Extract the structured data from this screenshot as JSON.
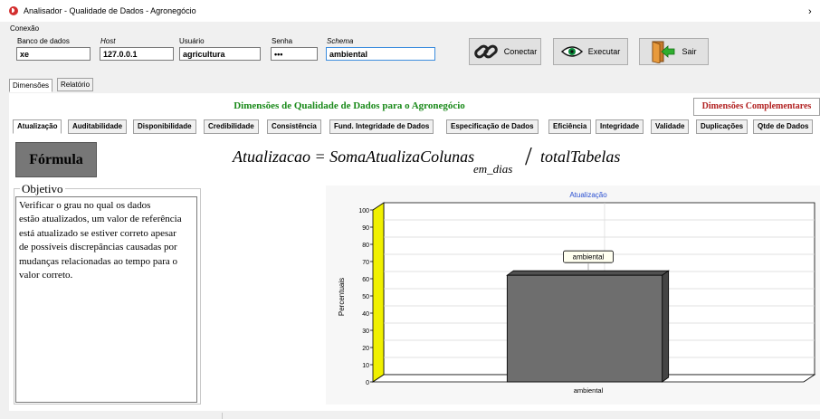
{
  "window": {
    "title": "Analisador - Qualidade de Dados - Agronegócio",
    "close_glyph": "›",
    "app_icon": "red-circle-app-icon"
  },
  "connection": {
    "group_label": "Conexão",
    "fields": [
      {
        "label": "Banco de dados",
        "value": "xe"
      },
      {
        "label": "Host",
        "value": "127.0.0.1"
      },
      {
        "label": "Usuário",
        "value": "agricultura"
      },
      {
        "label": "Senha",
        "value": "•••"
      },
      {
        "label": "Schema",
        "value": "ambiental"
      }
    ],
    "buttons": {
      "connect": "Conectar",
      "execute": "Executar",
      "exit": "Sair"
    }
  },
  "main_tabs": [
    "Dimensões",
    "Relatório"
  ],
  "headings": {
    "main": "Dimensões de Qualidade de Dados para o Agronegócio",
    "complementary": "Dimensões Complementares"
  },
  "dimension_tabs": [
    "Atualização",
    "Auditabilidade",
    "Disponibilidade",
    "Credibilidade",
    "Consistência",
    "Fund. Integridade de Dados",
    "Especificação de Dados",
    "Eficiência",
    "Integridade",
    "Validade",
    "Duplicações",
    "Qtde de Dados"
  ],
  "formula": {
    "label": "Fórmula",
    "lhs": "Atualizacao = SomaAtualizaColunas",
    "subscript": "em_dias",
    "slash": "/",
    "rhs": "totalTabelas"
  },
  "objective": {
    "legend": "Objetivo",
    "lines": [
      "Verificar o grau no qual os dados",
      "estão atualizados, um valor de referência",
      "está atualizado se estiver correto apesar",
      "de possíveis discrepâncias causadas por",
      "mudanças relacionadas ao tempo para o",
      "valor correto."
    ]
  },
  "colors": {
    "heading_green": "#1a8a1a",
    "heading_red": "#b22222",
    "bar_gray": "#6e6e6e",
    "axis_wall_yellow": "#f0f000",
    "chart_title_blue": "#2a4fd1"
  },
  "chart_data": {
    "type": "bar",
    "title": "Atualização",
    "ylabel": "Percentuais",
    "xlabel": "",
    "categories": [
      "ambiental"
    ],
    "series": [
      {
        "values": [
          62
        ]
      }
    ],
    "data_labels": [
      "ambiental"
    ],
    "ylim": [
      0,
      100
    ],
    "yticks": [
      0,
      10,
      20,
      30,
      40,
      50,
      60,
      70,
      80,
      90,
      100
    ],
    "style": "3d",
    "grid": true
  }
}
